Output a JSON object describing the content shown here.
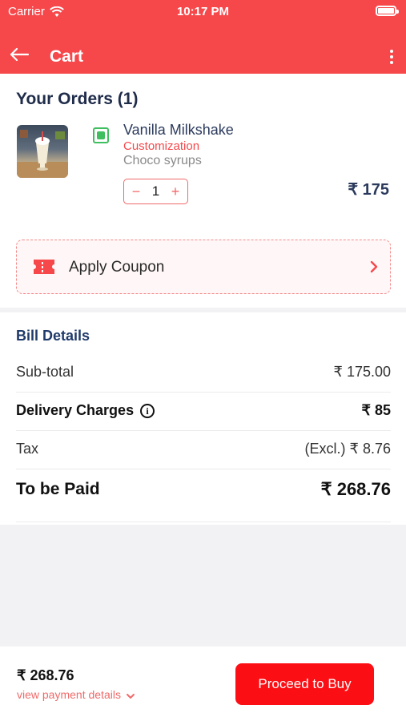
{
  "status_bar": {
    "carrier": "Carrier",
    "time": "10:17 PM"
  },
  "header": {
    "title": "Cart"
  },
  "orders": {
    "title": "Your Orders (1)",
    "item": {
      "name": "Vanilla Milkshake",
      "customization_label": "Customization",
      "customization_detail": "Choco syrups",
      "quantity": "1",
      "price": "₹ 175"
    }
  },
  "coupon": {
    "label": "Apply Coupon"
  },
  "bill": {
    "title": "Bill Details",
    "subtotal_label": "Sub-total",
    "subtotal_value": "₹ 175.00",
    "delivery_label": "Delivery Charges",
    "delivery_value": "₹ 85",
    "tax_label": "Tax",
    "tax_value": "(Excl.) ₹ 8.76",
    "total_label": "To be Paid",
    "total_value": "₹ 268.76"
  },
  "footer": {
    "total": "₹ 268.76",
    "details_link": "view payment details",
    "proceed_label": "Proceed to Buy"
  },
  "colors": {
    "brand": "#f6484b",
    "cta": "#fc0f14",
    "veg": "#3fbf5f"
  }
}
